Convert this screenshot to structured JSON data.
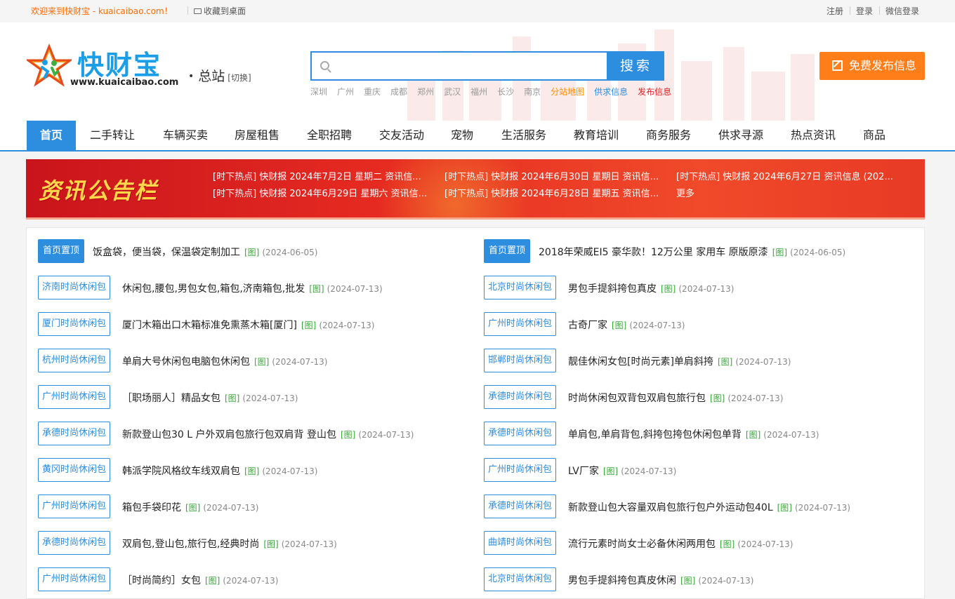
{
  "topbar": {
    "welcome": "欢迎来到快财宝 - kuaicaibao.com！",
    "favorite": "收藏到桌面",
    "register": "注册",
    "login": "登录",
    "wechat_login": "微信登录"
  },
  "header": {
    "brand": "快财宝",
    "url": "www.kuaicaibao.com",
    "station": "总站",
    "switch": "[切换]",
    "search_placeholder": "",
    "search_button": "搜索",
    "cities": [
      "深圳",
      "广州",
      "重庆",
      "成都",
      "郑州",
      "武汉",
      "福州",
      "长沙",
      "南京"
    ],
    "city_map": "分站地图",
    "supply_info": "供求信息",
    "publish_info": "发布信息",
    "post_button": "免费发布信息"
  },
  "nav": [
    "首页",
    "二手转让",
    "车辆买卖",
    "房屋租售",
    "全职招聘",
    "交友活动",
    "宠物",
    "生活服务",
    "教育培训",
    "商务服务",
    "供求寻源",
    "热点资讯",
    "商品"
  ],
  "banner": {
    "title": "资讯公告栏",
    "news": [
      "[时下热点] 快财报 2024年7月2日 星期二 资讯信...",
      "[时下热点] 快财报 2024年6月30日 星期日 资讯信...",
      "[时下热点] 快财报 2024年6月27日 资讯信息 (202...",
      "[时下热点] 快财报 2024年6月29日 星期六 资讯信...",
      "[时下热点] 快财报 2024年6月28日 星期五 资讯信...",
      "更多"
    ]
  },
  "listings": {
    "pic_label": "[图]",
    "left": [
      {
        "badge": "首页置顶",
        "title": "饭盒袋，便当袋，保温袋定制加工",
        "date": "(2024-06-05)",
        "top": true
      },
      {
        "badge": "济南时尚休闲包",
        "title": "休闲包,腰包,男包女包,箱包,济南箱包,批发",
        "date": "(2024-07-13)"
      },
      {
        "badge": "厦门时尚休闲包",
        "title": "厦门木箱出口木箱标准免熏蒸木箱[厦门]",
        "date": "(2024-07-13)"
      },
      {
        "badge": "杭州时尚休闲包",
        "title": "单肩大号休闲包电脑包休闲包",
        "date": "(2024-07-13)"
      },
      {
        "badge": "广州时尚休闲包",
        "title": "［职场丽人］精品女包",
        "date": "(2024-07-13)"
      },
      {
        "badge": "承德时尚休闲包",
        "title": "新款登山包30 L 户外双肩包旅行包双肩背 登山包",
        "date": "(2024-07-13)"
      },
      {
        "badge": "黄冈时尚休闲包",
        "title": "韩派学院风格纹车线双肩包",
        "date": "(2024-07-13)"
      },
      {
        "badge": "广州时尚休闲包",
        "title": "箱包手袋印花",
        "date": "(2024-07-13)"
      },
      {
        "badge": "承德时尚休闲包",
        "title": "双肩包,登山包,旅行包,经典时尚",
        "date": "(2024-07-13)"
      },
      {
        "badge": "广州时尚休闲包",
        "title": "［时尚简约］女包",
        "date": "(2024-07-13)"
      }
    ],
    "right": [
      {
        "badge": "首页置顶",
        "title": "2018年荣威EI5 豪华款！12万公里 家用车 原版原漆",
        "date": "(2024-06-05)",
        "top": true
      },
      {
        "badge": "北京时尚休闲包",
        "title": "男包手提斜挎包真皮",
        "date": "(2024-07-13)"
      },
      {
        "badge": "广州时尚休闲包",
        "title": "古奇厂家",
        "date": "(2024-07-13)"
      },
      {
        "badge": "邯郸时尚休闲包",
        "title": "靓佳休闲女包[时尚元素]单肩斜挎",
        "date": "(2024-07-13)"
      },
      {
        "badge": "承德时尚休闲包",
        "title": "时尚休闲包双背包双肩包旅行包",
        "date": "(2024-07-13)"
      },
      {
        "badge": "承德时尚休闲包",
        "title": "单肩包,单肩背包,斜挎包挎包休闲包单背",
        "date": "(2024-07-13)"
      },
      {
        "badge": "广州时尚休闲包",
        "title": "LV厂家",
        "date": "(2024-07-13)"
      },
      {
        "badge": "承德时尚休闲包",
        "title": "新款登山包大容量双肩包旅行包户外运动包40L",
        "date": "(2024-07-13)"
      },
      {
        "badge": "曲靖时尚休闲包",
        "title": "流行元素时尚女士必备休闲两用包",
        "date": "(2024-07-13)"
      },
      {
        "badge": "北京时尚休闲包",
        "title": "男包手提斜挎包真皮休闲",
        "date": "(2024-07-13)"
      }
    ]
  }
}
